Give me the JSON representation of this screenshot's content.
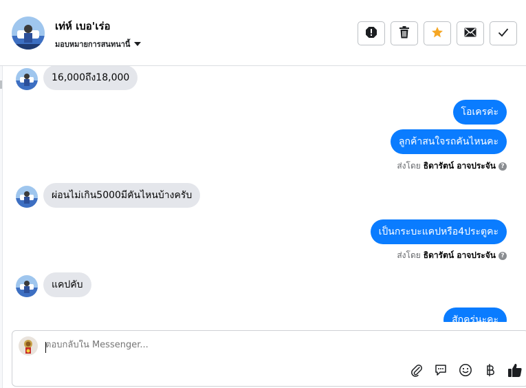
{
  "header": {
    "contact_name": "เท่ห์ เบอ'เร่อ",
    "assign_label": "มอบหมายการสนทนานี้",
    "actions": [
      "spam",
      "delete",
      "star",
      "mark-unread",
      "done"
    ],
    "star_color": "#f5a623"
  },
  "messages": [
    {
      "side": "in",
      "text": "16,000ถึง18,000"
    },
    {
      "side": "out",
      "text": "โอเครค่ะ"
    },
    {
      "side": "out",
      "text": "ลูกค้าสนใจรถคันไหนคะ"
    },
    {
      "side": "meta",
      "prefix": "ส่งโดย",
      "sender": "ธิดารัตน์ อาจประจัน",
      "help": "?"
    },
    {
      "side": "in",
      "text": "ผ่อนไม่เกิน5000มีคันไหนบ้างครับ"
    },
    {
      "side": "out",
      "text": "เป็นกระบะแคปหรือ4ประตูคะ"
    },
    {
      "side": "meta",
      "prefix": "ส่งโดย",
      "sender": "ธิดารัตน์ อาจประจัน",
      "help": "?"
    },
    {
      "side": "in",
      "text": "แคปคับ"
    },
    {
      "side": "out",
      "text": "สักครู่นะคะ"
    }
  ],
  "composer": {
    "placeholder": "ตอบกลับใน Messenger...",
    "tools": [
      "paperclip-icon",
      "saved-reply-icon",
      "emoji-icon",
      "baht-icon",
      "thumbs-up-icon"
    ]
  },
  "colors": {
    "outgoing_bubble": "#0a7cff",
    "incoming_bubble": "#e4e6eb"
  }
}
